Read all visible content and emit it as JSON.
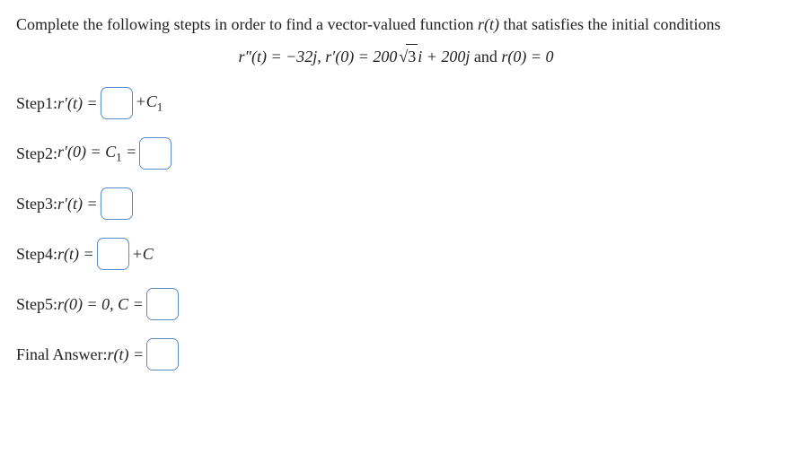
{
  "prompt_line1": "Complete the following stepts in order to find a vector-valued function ",
  "prompt_rt": "r(t)",
  "prompt_line1b": " that satisfies the initial conditions",
  "conditions": {
    "part1": "r″(t) = −32j, r′(0) = 200",
    "sqrt_val": "3",
    "part2": "i + 200j",
    "and": " and ",
    "part3": "r(0) = 0"
  },
  "steps": {
    "s1": {
      "label": "Step1: ",
      "lhs_pre": "r′(t) =",
      "tail": "+C",
      "sub": "1"
    },
    "s2": {
      "label": "Step2: ",
      "lhs_pre": "r′(0) = C",
      "sub": "1",
      "eq": " ="
    },
    "s3": {
      "label": "Step3: ",
      "lhs_pre": "r′(t) ="
    },
    "s4": {
      "label": "Step4: ",
      "lhs_pre": "r(t) =",
      "tail": "+C"
    },
    "s5": {
      "label": "Step5: ",
      "lhs_pre": "r(0) = 0, C ="
    },
    "fa": {
      "label": "Final Answer: ",
      "lhs_pre": "r(t) ="
    }
  }
}
